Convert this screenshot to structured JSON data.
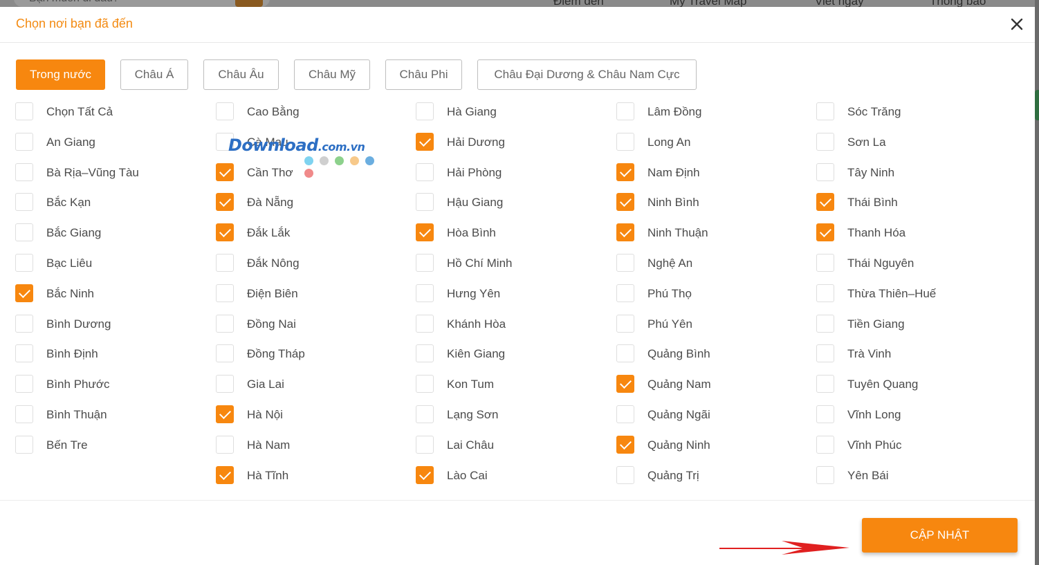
{
  "background": {
    "search_placeholder": "Bạn muốn đi đâu?",
    "nav": [
      "Điểm đến",
      "My Travel Map",
      "Viết ngay",
      "Thông báo"
    ]
  },
  "modal": {
    "title": "Chọn nơi bạn đã đến",
    "close_icon": "close-icon",
    "accent_color": "#f7870f",
    "tabs": [
      {
        "label": "Trong nước",
        "active": true
      },
      {
        "label": "Châu Á",
        "active": false
      },
      {
        "label": "Châu Âu",
        "active": false
      },
      {
        "label": "Châu Mỹ",
        "active": false
      },
      {
        "label": "Châu Phi",
        "active": false
      },
      {
        "label": "Châu Đại Dương & Châu Nam Cực",
        "active": false
      }
    ],
    "columns": [
      [
        {
          "label": "Chọn Tất Cả",
          "checked": false
        },
        {
          "label": "An Giang",
          "checked": false
        },
        {
          "label": "Bà Rịa–Vũng Tàu",
          "checked": false
        },
        {
          "label": "Bắc Kạn",
          "checked": false
        },
        {
          "label": "Bắc Giang",
          "checked": false
        },
        {
          "label": "Bạc Liêu",
          "checked": false
        },
        {
          "label": "Bắc Ninh",
          "checked": true
        },
        {
          "label": "Bình Dương",
          "checked": false
        },
        {
          "label": "Bình Định",
          "checked": false
        },
        {
          "label": "Bình Phước",
          "checked": false
        },
        {
          "label": "Bình Thuận",
          "checked": false
        },
        {
          "label": "Bến Tre",
          "checked": false
        }
      ],
      [
        {
          "label": "Cao Bằng",
          "checked": false
        },
        {
          "label": "Cà Mau",
          "checked": false
        },
        {
          "label": "Cần Thơ",
          "checked": true
        },
        {
          "label": "Đà Nẵng",
          "checked": true
        },
        {
          "label": "Đắk Lắk",
          "checked": true
        },
        {
          "label": "Đắk Nông",
          "checked": false
        },
        {
          "label": "Điện Biên",
          "checked": false
        },
        {
          "label": "Đồng Nai",
          "checked": false
        },
        {
          "label": "Đồng Tháp",
          "checked": false
        },
        {
          "label": "Gia Lai",
          "checked": false
        },
        {
          "label": "Hà Nội",
          "checked": true
        },
        {
          "label": "Hà Nam",
          "checked": false
        },
        {
          "label": "Hà Tĩnh",
          "checked": true
        }
      ],
      [
        {
          "label": "Hà Giang",
          "checked": false
        },
        {
          "label": "Hải Dương",
          "checked": true
        },
        {
          "label": "Hải Phòng",
          "checked": false
        },
        {
          "label": "Hậu Giang",
          "checked": false
        },
        {
          "label": "Hòa Bình",
          "checked": true
        },
        {
          "label": "Hồ Chí Minh",
          "checked": false
        },
        {
          "label": "Hưng Yên",
          "checked": false
        },
        {
          "label": "Khánh Hòa",
          "checked": false
        },
        {
          "label": "Kiên Giang",
          "checked": false
        },
        {
          "label": "Kon Tum",
          "checked": false
        },
        {
          "label": "Lạng Sơn",
          "checked": false
        },
        {
          "label": "Lai Châu",
          "checked": false
        },
        {
          "label": "Lào Cai",
          "checked": true
        }
      ],
      [
        {
          "label": "Lâm Đồng",
          "checked": false
        },
        {
          "label": "Long An",
          "checked": false
        },
        {
          "label": "Nam Định",
          "checked": true
        },
        {
          "label": "Ninh Bình",
          "checked": true
        },
        {
          "label": "Ninh Thuận",
          "checked": true
        },
        {
          "label": "Nghệ An",
          "checked": false
        },
        {
          "label": "Phú Thọ",
          "checked": false
        },
        {
          "label": "Phú Yên",
          "checked": false
        },
        {
          "label": "Quảng Bình",
          "checked": false
        },
        {
          "label": "Quảng Nam",
          "checked": true
        },
        {
          "label": "Quảng Ngãi",
          "checked": false
        },
        {
          "label": "Quảng Ninh",
          "checked": true
        },
        {
          "label": "Quảng Trị",
          "checked": false
        }
      ],
      [
        {
          "label": "Sóc Trăng",
          "checked": false
        },
        {
          "label": "Sơn La",
          "checked": false
        },
        {
          "label": "Tây Ninh",
          "checked": false
        },
        {
          "label": "Thái Bình",
          "checked": true
        },
        {
          "label": "Thanh Hóa",
          "checked": true
        },
        {
          "label": "Thái Nguyên",
          "checked": false
        },
        {
          "label": "Thừa Thiên–Huế",
          "checked": false
        },
        {
          "label": "Tiền Giang",
          "checked": false
        },
        {
          "label": "Trà Vinh",
          "checked": false
        },
        {
          "label": "Tuyên Quang",
          "checked": false
        },
        {
          "label": "Vĩnh Long",
          "checked": false
        },
        {
          "label": "Vĩnh Phúc",
          "checked": false
        },
        {
          "label": "Yên Bái",
          "checked": false
        }
      ]
    ],
    "update_button": "CẬP NHẬT"
  },
  "watermark": {
    "text": "Download",
    "suffix": ".com.vn",
    "dot_colors": [
      "#7fd3f0",
      "#cfcfcf",
      "#8dd18c",
      "#f7c98a",
      "#6baee0",
      "#f08a8a"
    ]
  },
  "annotation": {
    "arrow_color": "#e02020"
  }
}
